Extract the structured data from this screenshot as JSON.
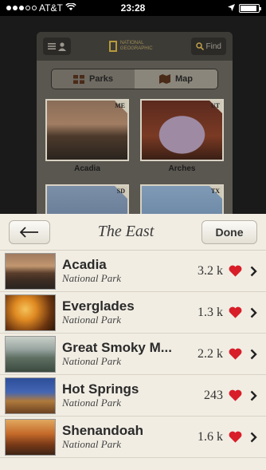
{
  "status_bar": {
    "carrier": "AT&T",
    "time": "23:28"
  },
  "background_app": {
    "find_label": "Find",
    "logo_line1": "NATIONAL",
    "logo_line2": "GEOGRAPHIC",
    "tabs": [
      {
        "label": "Parks",
        "selected": true
      },
      {
        "label": "Map",
        "selected": false
      }
    ],
    "thumbnails": [
      {
        "label": "Acadia",
        "state": "ME"
      },
      {
        "label": "Arches",
        "state": "UT"
      },
      {
        "label": "",
        "state": "SD"
      },
      {
        "label": "",
        "state": "TX"
      }
    ]
  },
  "sheet": {
    "title": "The East",
    "done_label": "Done",
    "parks": [
      {
        "name": "Acadia",
        "type": "National Park",
        "likes": "3.2 k"
      },
      {
        "name": "Everglades",
        "type": "National Park",
        "likes": "1.3 k"
      },
      {
        "name": "Great Smoky M...",
        "type": "National Park",
        "likes": "2.2 k"
      },
      {
        "name": "Hot Springs",
        "type": "National Park",
        "likes": "243"
      },
      {
        "name": "Shenandoah",
        "type": "National Park",
        "likes": "1.6 k"
      }
    ]
  },
  "colors": {
    "heart": "#d81e28",
    "logo_yellow": "#b69a3a"
  },
  "icons": [
    "wifi-icon",
    "location-arrow-icon",
    "battery-icon",
    "list-icon",
    "person-icon",
    "search-icon",
    "parks-grid-icon",
    "map-icon",
    "back-arrow-icon",
    "heart-icon",
    "chevron-right-icon"
  ]
}
